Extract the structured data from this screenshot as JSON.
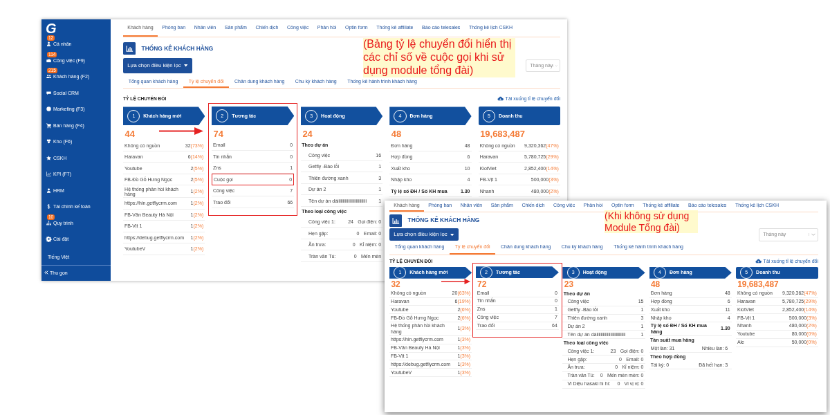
{
  "screens": [
    {
      "kind": "main",
      "sidebar": {
        "logo": "G",
        "items": [
          {
            "label": "Cá nhân",
            "badge": "12"
          },
          {
            "label": "Công việc (F9)",
            "badge": "114"
          },
          {
            "label": "Khách hàng (F2)",
            "badge": "215"
          },
          {
            "label": "Social CRM"
          },
          {
            "label": "Marketing (F3)"
          },
          {
            "label": "Bán hàng (F4)"
          },
          {
            "label": "Kho (F6)"
          },
          {
            "label": "CSKH"
          },
          {
            "label": "KPI (F7)"
          },
          {
            "label": "HRM"
          },
          {
            "label": "Tài chính kế toán"
          },
          {
            "label": "Quy trình",
            "badge": "10"
          },
          {
            "label": "Cài đặt"
          }
        ],
        "language": "Tiếng Việt",
        "collapse": "Thu gọn"
      },
      "tabs": [
        {
          "label": "Khách hàng",
          "selected": true
        },
        {
          "label": "Phòng ban",
          "selected": false
        },
        {
          "label": "Nhân viên",
          "selected": false
        },
        {
          "label": "Sản phẩm",
          "selected": false
        },
        {
          "label": "Chiến dịch",
          "selected": false
        },
        {
          "label": "Công việc",
          "selected": false
        },
        {
          "label": "Phản hồi",
          "selected": false
        },
        {
          "label": "Optin form",
          "selected": false
        },
        {
          "label": "Thống kê affiliate",
          "selected": false
        },
        {
          "label": "Báo cáo telesales",
          "selected": false
        },
        {
          "label": "Thống kê lịch CSKH",
          "selected": false
        }
      ],
      "title": "THỐNG KÊ KHÁCH HÀNG",
      "filter_button": "Lựa chọn điều kiện lọc",
      "date_select": "Tháng này",
      "sub_tabs": [
        {
          "label": "Tổng quan khách hàng",
          "selected": false
        },
        {
          "label": "Tỷ lệ chuyển đổi",
          "selected": true
        },
        {
          "label": "Chân dung khách hàng",
          "selected": false
        },
        {
          "label": "Chu kỳ khách hàng",
          "selected": false
        },
        {
          "label": "Thống kê hành trình khách hàng",
          "selected": false
        }
      ],
      "section_title": "TỶ LỆ CHUYỂN ĐỔI",
      "download_link": "Tải xuống tỉ lệ chuyển đổi",
      "note": "(Bảng tỷ lệ chuyển đổi hiển thị các chỉ số về cuộc gọi khi sử dụng module tổng đài)",
      "stages": [
        {
          "number": "1",
          "label": "Khách hàng mới",
          "total": "44",
          "highlighted": false,
          "rows": [
            {
              "kind": "item",
              "label": "Không có nguồn",
              "value": "32",
              "percent": "(73%)"
            },
            {
              "kind": "item",
              "label": "Haravan",
              "value": "6",
              "percent": "(14%)"
            },
            {
              "kind": "item",
              "label": "Youtube",
              "value": "2",
              "percent": "(5%)"
            },
            {
              "kind": "item",
              "label": "FB-Đồ Gỗ Hưng Ngọc",
              "value": "2",
              "percent": "(5%)"
            },
            {
              "kind": "item",
              "label": "Hệ thống phản hồi khách hàng",
              "value": "1",
              "percent": "(2%)"
            },
            {
              "kind": "item",
              "label": "https://hin.getflycrm.com",
              "value": "1",
              "percent": "(2%)"
            },
            {
              "kind": "item",
              "label": "FB-Văn Beauty Hà Nội",
              "value": "1",
              "percent": "(2%)"
            },
            {
              "kind": "item",
              "label": "FB-Vịt 1",
              "value": "1",
              "percent": "(2%)"
            },
            {
              "kind": "item",
              "label": "https://debug.getflycrm.com",
              "value": "1",
              "percent": "(2%)"
            },
            {
              "kind": "item",
              "label": "YoutubeV",
              "value": "1",
              "percent": "(2%)"
            }
          ]
        },
        {
          "number": "2",
          "label": "Tương tác",
          "total": "74",
          "highlighted": true,
          "rows": [
            {
              "kind": "item",
              "label": "Email",
              "value": "0",
              "highlighted": false
            },
            {
              "kind": "item",
              "label": "Tin nhắn",
              "value": "0",
              "highlighted": false
            },
            {
              "kind": "item",
              "label": "Zns",
              "value": "1",
              "highlighted": false
            },
            {
              "kind": "item",
              "label": "Cuộc gọi",
              "value": "0",
              "highlighted": true
            },
            {
              "kind": "item",
              "label": "Công việc",
              "value": "7",
              "highlighted": false
            },
            {
              "kind": "item",
              "label": "Trao đổi",
              "value": "66",
              "highlighted": false
            }
          ]
        },
        {
          "number": "3",
          "label": "Hoạt động",
          "total": "24",
          "highlighted": false,
          "rows": [
            {
              "kind": "heading",
              "label": "Theo dự án"
            },
            {
              "kind": "item",
              "label": "Công việc",
              "value": "16"
            },
            {
              "kind": "item",
              "label": "Getfly -Báo lỗi",
              "value": "1"
            },
            {
              "kind": "item",
              "label": "Thiên đường xanh",
              "value": "3"
            },
            {
              "kind": "item",
              "label": "Dự án 2",
              "value": "1"
            },
            {
              "kind": "item",
              "label": "Tên dự án dàiiiiiiiiiiiiiiiiiiiiiiiiiii",
              "value": "1"
            },
            {
              "kind": "heading",
              "label": "Theo loại công việc"
            },
            {
              "kind": "pair",
              "left": "Công việc 1:",
              "left_value": "24",
              "right": "Gọi điện: 0"
            },
            {
              "kind": "pair",
              "left": "Hẹn gặp:",
              "left_value": "0",
              "right": "Email: 0"
            },
            {
              "kind": "pair",
              "left": "Ăn trưa:",
              "left_value": "0",
              "right": "Kỉ niệm: 0"
            },
            {
              "kind": "pair",
              "left": "Trần văn Tú:",
              "left_value": "0",
              "right": "Mến mèn"
            }
          ]
        },
        {
          "number": "4",
          "label": "Đơn hàng",
          "total": "48",
          "highlighted": false,
          "rows": [
            {
              "kind": "item",
              "label": "Đơn hàng",
              "value": "48"
            },
            {
              "kind": "item",
              "label": "Hợp đồng",
              "value": "6"
            },
            {
              "kind": "item",
              "label": "Xuất kho",
              "value": "10"
            },
            {
              "kind": "item",
              "label": "Nhập kho",
              "value": "4"
            },
            {
              "kind": "bold",
              "label": "Tỷ lệ số ĐH / Số KH mua",
              "value": "1.30"
            }
          ]
        },
        {
          "number": "5",
          "label": "Doanh thu",
          "total": "19,683,487",
          "highlighted": false,
          "rows": [
            {
              "kind": "item",
              "label": "Không có nguồn",
              "value": "9,320,362",
              "percent": "(47%)"
            },
            {
              "kind": "item",
              "label": "Haravan",
              "value": "5,780,725",
              "percent": "(29%)"
            },
            {
              "kind": "item",
              "label": "KiotViet",
              "value": "2,852,400",
              "percent": "(14%)"
            },
            {
              "kind": "item",
              "label": "FB-Vịt 1",
              "value": "500,000",
              "percent": "(3%)"
            },
            {
              "kind": "item",
              "label": "Nhanh",
              "value": "480,000",
              "percent": "(2%)"
            }
          ]
        }
      ]
    },
    {
      "kind": "inset",
      "tabs": [
        {
          "label": "Khách hàng",
          "selected": true
        },
        {
          "label": "Phòng ban",
          "selected": false
        },
        {
          "label": "Nhân viên",
          "selected": false
        },
        {
          "label": "Sản phẩm",
          "selected": false
        },
        {
          "label": "Chiến dịch",
          "selected": false
        },
        {
          "label": "Công việc",
          "selected": false
        },
        {
          "label": "Phản hồi",
          "selected": false
        },
        {
          "label": "Optin form",
          "selected": false
        },
        {
          "label": "Thống kê affiliate",
          "selected": false
        },
        {
          "label": "Báo cáo telesales",
          "selected": false
        },
        {
          "label": "Thống kê lịch CSKH",
          "selected": false
        }
      ],
      "title": "THỐNG KÊ KHÁCH HÀNG",
      "filter_button": "Lựa chọn điều kiện lọc",
      "date_select": "Tháng này",
      "sub_tabs": [
        {
          "label": "Tổng quan khách hàng",
          "selected": false
        },
        {
          "label": "Tỷ lệ chuyển đổi",
          "selected": true
        },
        {
          "label": "Chân dung khách hàng",
          "selected": false
        },
        {
          "label": "Chu kỳ khách hàng",
          "selected": false
        },
        {
          "label": "Thống kê hành trình khách hàng",
          "selected": false
        }
      ],
      "section_title": "TỶ LỆ CHUYỂN ĐỔI",
      "download_link": "Tải xuống tỉ lệ chuyển đổi",
      "note": "(Khi không sử dụng Module Tổng đài)",
      "stages": [
        {
          "number": "1",
          "label": "Khách hàng mới",
          "total": "32",
          "highlighted": false,
          "rows": [
            {
              "kind": "item",
              "label": "Không có nguồn",
              "value": "20",
              "percent": "(63%)"
            },
            {
              "kind": "item",
              "label": "Haravan",
              "value": "6",
              "percent": "(19%)"
            },
            {
              "kind": "item",
              "label": "Youtube",
              "value": "2",
              "percent": "(6%)"
            },
            {
              "kind": "item",
              "label": "FB-Đồ Gỗ Hưng Ngọc",
              "value": "2",
              "percent": "(6%)"
            },
            {
              "kind": "item",
              "label": "Hệ thống phản hồi khách hàng",
              "value": "1",
              "percent": "(3%)"
            },
            {
              "kind": "item",
              "label": "https://hin.getflycrm.com",
              "value": "1",
              "percent": "(3%)"
            },
            {
              "kind": "item",
              "label": "FB-Văn Beauty Hà Nội",
              "value": "1",
              "percent": "(3%)"
            },
            {
              "kind": "item",
              "label": "FB-Vịt 1",
              "value": "1",
              "percent": "(3%)"
            },
            {
              "kind": "item",
              "label": "https://debug.getflycrm.com",
              "value": "1",
              "percent": "(3%)"
            },
            {
              "kind": "item",
              "label": "YoutubeV",
              "value": "1",
              "percent": "(3%)"
            }
          ]
        },
        {
          "number": "2",
          "label": "Tương tác",
          "total": "72",
          "highlighted": true,
          "rows": [
            {
              "kind": "item",
              "label": "Email",
              "value": "0"
            },
            {
              "kind": "item",
              "label": "Tin nhắn",
              "value": "0"
            },
            {
              "kind": "item",
              "label": "Zns",
              "value": "1"
            },
            {
              "kind": "item",
              "label": "Công việc",
              "value": "7"
            },
            {
              "kind": "item",
              "label": "Trao đổi",
              "value": "64"
            }
          ]
        },
        {
          "number": "3",
          "label": "Hoạt động",
          "total": "23",
          "highlighted": false,
          "rows": [
            {
              "kind": "heading",
              "label": "Theo dự án"
            },
            {
              "kind": "item",
              "label": "Công việc",
              "value": "15"
            },
            {
              "kind": "item",
              "label": "Getfly -Báo lỗi",
              "value": "1"
            },
            {
              "kind": "item",
              "label": "Thiên đường xanh",
              "value": "3"
            },
            {
              "kind": "item",
              "label": "Dự án 2",
              "value": "1"
            },
            {
              "kind": "item",
              "label": "Tên dự án dàiiiiiiiiiiiiiiiiiiiiiiiiiii",
              "value": "1"
            },
            {
              "kind": "heading",
              "label": "Theo loại công việc"
            },
            {
              "kind": "pair",
              "left": "Công việc 1:",
              "left_value": "23",
              "right": "Gọi điện: 0"
            },
            {
              "kind": "pair",
              "left": "Hẹn gặp:",
              "left_value": "0",
              "right": "Email: 0"
            },
            {
              "kind": "pair",
              "left": "Ăn trưa:",
              "left_value": "0",
              "right": "Kỉ niệm: 0"
            },
            {
              "kind": "pair",
              "left": "Trần văn Tú:",
              "left_value": "0",
              "right": "Mến mèn mèn: 0"
            },
            {
              "kind": "pair",
              "left": "Vi Diệu hasaki hì hì:",
              "left_value": "0",
              "right": "Vi vị vị: 0"
            }
          ]
        },
        {
          "number": "4",
          "label": "Đơn hàng",
          "total": "48",
          "highlighted": false,
          "rows": [
            {
              "kind": "item",
              "label": "Đơn hàng",
              "value": "48"
            },
            {
              "kind": "item",
              "label": "Hợp đồng",
              "value": "6"
            },
            {
              "kind": "item",
              "label": "Xuất kho",
              "value": "11"
            },
            {
              "kind": "item",
              "label": "Nhập kho",
              "value": "4"
            },
            {
              "kind": "bold",
              "label": "Tỷ lệ số ĐH / Số KH mua hàng",
              "value": "1.30"
            },
            {
              "kind": "heading",
              "label": "Tần suất mua hàng"
            },
            {
              "kind": "pair",
              "left": "Một lần: 31",
              "right": "Nhiều lần: 6"
            },
            {
              "kind": "heading",
              "label": "Theo hợp đồng"
            },
            {
              "kind": "pair",
              "left": "Tái ký: 0",
              "right": "Đã hết hạn: 3"
            }
          ]
        },
        {
          "number": "5",
          "label": "Doanh thu",
          "total": "19,683,487",
          "highlighted": false,
          "rows": [
            {
              "kind": "item",
              "label": "Không có nguồn",
              "value": "9,320,362",
              "percent": "(47%)"
            },
            {
              "kind": "item",
              "label": "Haravan",
              "value": "5,780,725",
              "percent": "(29%)"
            },
            {
              "kind": "item",
              "label": "KiotViet",
              "value": "2,852,400",
              "percent": "(14%)"
            },
            {
              "kind": "item",
              "label": "FB-Vịt 1",
              "value": "500,000",
              "percent": "(3%)"
            },
            {
              "kind": "item",
              "label": "Nhanh",
              "value": "480,000",
              "percent": "(2%)"
            },
            {
              "kind": "item",
              "label": "Youtube",
              "value": "80,000",
              "percent": "(0%)"
            },
            {
              "kind": "item",
              "label": "Ale",
              "value": "50,000",
              "percent": "(0%)"
            }
          ]
        }
      ]
    }
  ]
}
